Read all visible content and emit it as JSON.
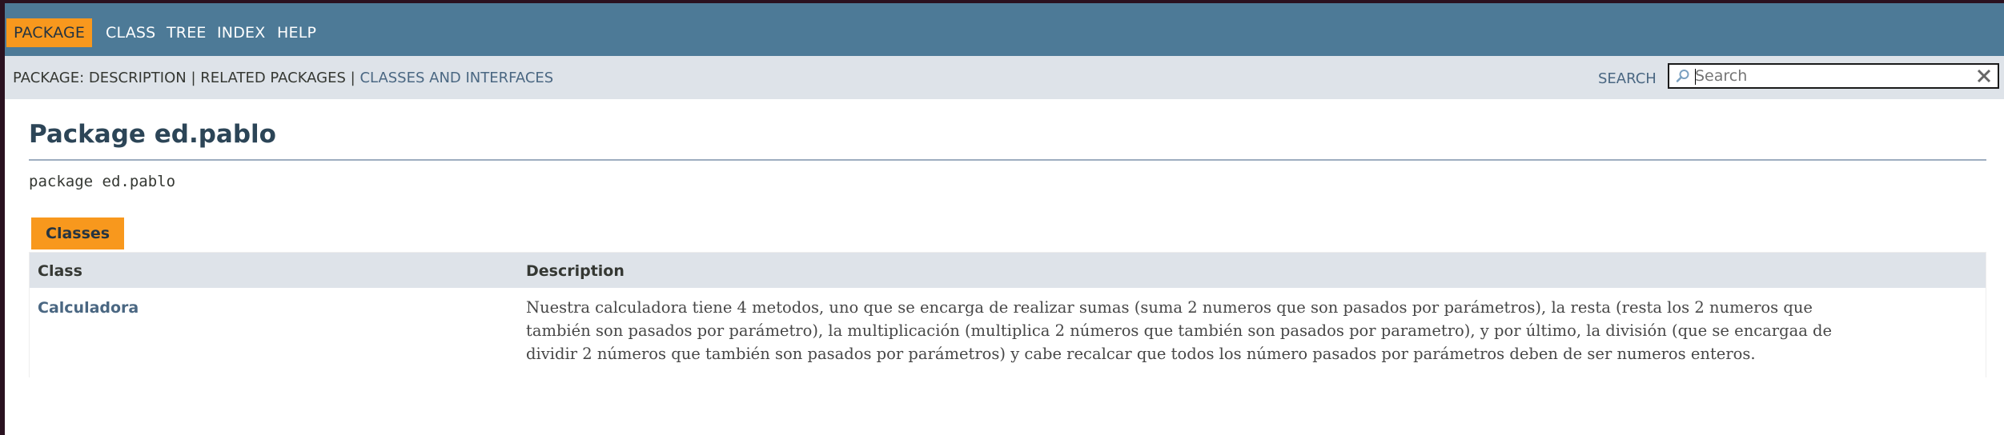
{
  "top_nav": {
    "items": [
      {
        "label": "PACKAGE",
        "active": true
      },
      {
        "label": "CLASS",
        "active": false
      },
      {
        "label": "TREE",
        "active": false
      },
      {
        "label": "INDEX",
        "active": false
      },
      {
        "label": "HELP",
        "active": false
      }
    ]
  },
  "sub_nav": {
    "prefix": "PACKAGE: ",
    "description": "DESCRIPTION",
    "separator1": " | ",
    "related": "RELATED PACKAGES",
    "separator2": " | ",
    "classes_link": "CLASSES AND INTERFACES"
  },
  "search": {
    "label": "SEARCH",
    "placeholder": "Search",
    "value": ""
  },
  "header": {
    "title": "Package ed.pablo",
    "declaration": "package ed.pablo"
  },
  "summary": {
    "tab_label": "Classes",
    "columns": [
      "Class",
      "Description"
    ],
    "rows": [
      {
        "class": "Calculadora",
        "description_lines": [
          "Nuestra calculadora tiene 4 metodos, uno que se encarga de realizar sumas (suma 2 numeros que son pasados por parámetros), la resta (resta los 2 numeros que",
          "también son pasados por parámetro), la multiplicación (multiplica 2 números que también son pasados por parametro), y por último, la división (que se encargaa de",
          "dividir 2 números que también son pasados por parámetros) y cabe recalcar que todos los número pasados por parámetros deben de ser numeros enteros."
        ]
      }
    ]
  },
  "colors": {
    "nav_bg": "#4d7a97",
    "subnav_bg": "#dee3e9",
    "accent": "#f8981d",
    "link": "#4a6782",
    "title": "#2c4557"
  }
}
